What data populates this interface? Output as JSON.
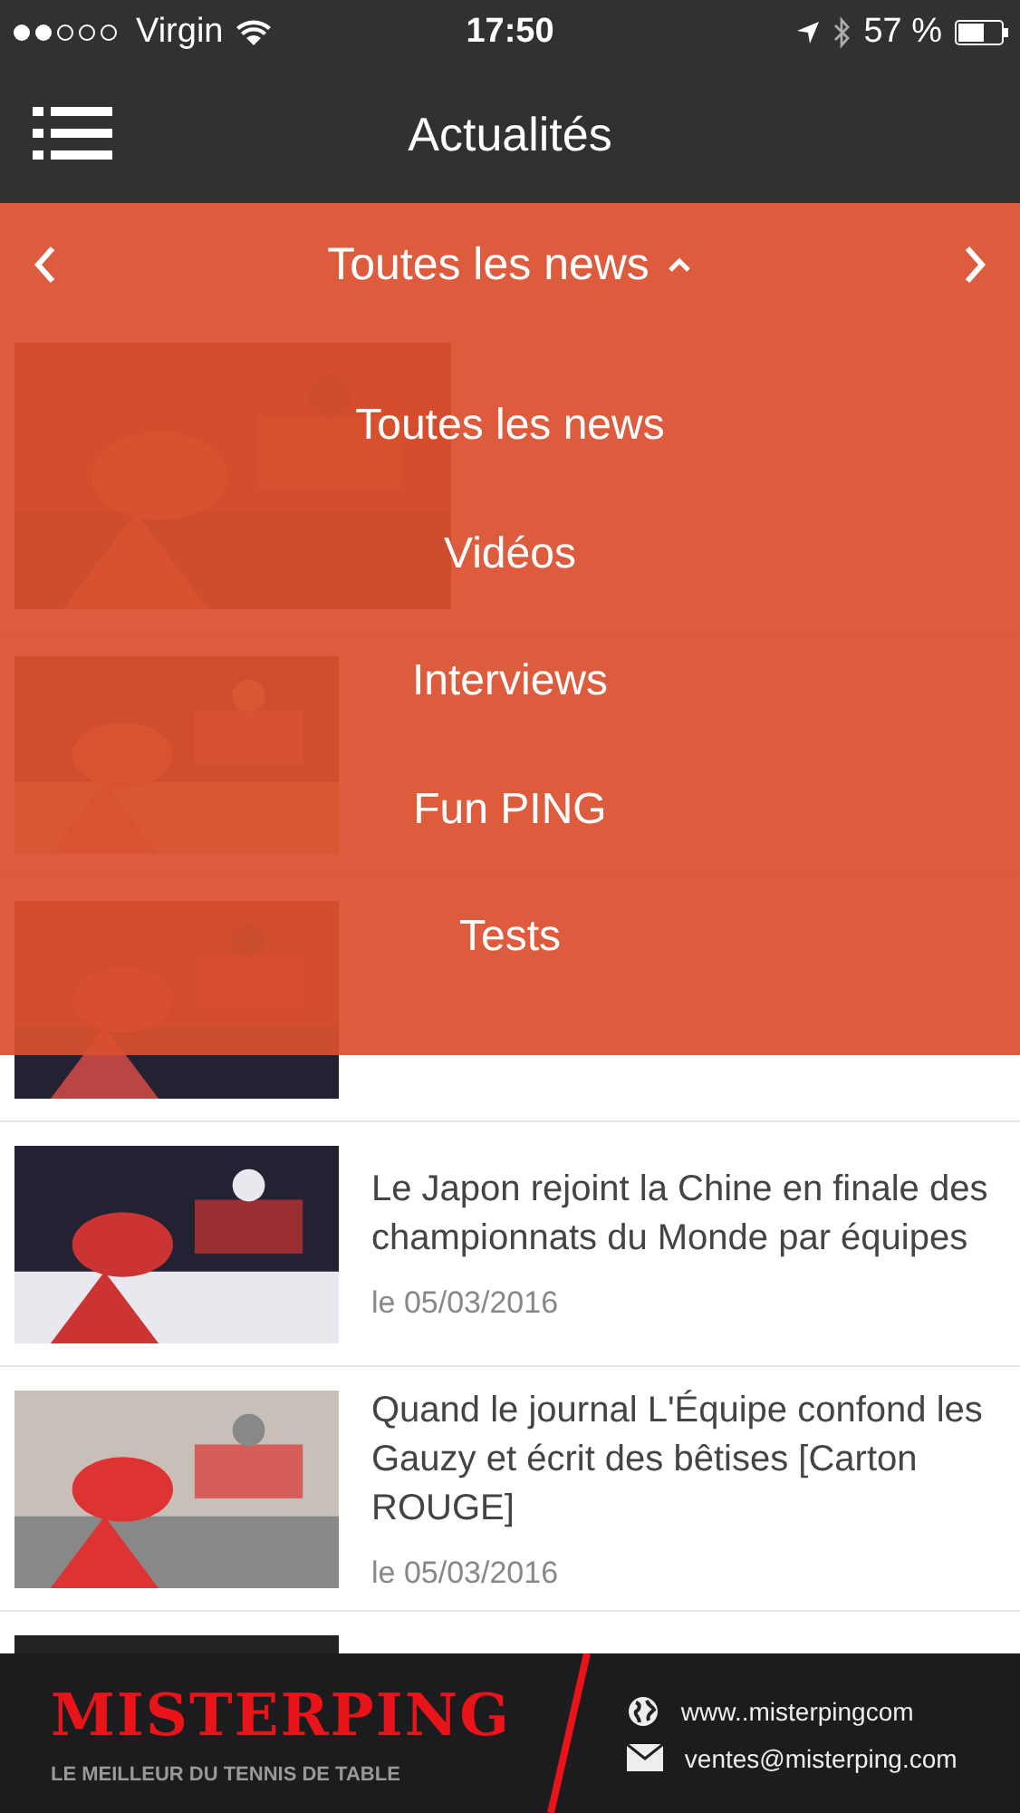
{
  "status_bar": {
    "carrier": "Virgin",
    "time": "17:50",
    "battery": "57 %"
  },
  "header": {
    "title": "Actualités"
  },
  "filter": {
    "current": "Toutes les news",
    "expanded": true,
    "options": [
      "Toutes les news",
      "Vidéos",
      "Interviews",
      "Fun PING",
      "Tests"
    ]
  },
  "articles": [
    {
      "kind": "covered"
    },
    {
      "kind": "covered"
    },
    {
      "kind": "covered"
    },
    {
      "kind": "article",
      "title": "Le Japon rejoint la Chine en finale des championnats du Monde par équipes",
      "date": "le 05/03/2016"
    },
    {
      "kind": "article",
      "title": "Quand le journal L'Équipe confond les Gauzy et écrit des bêtises [Carton ROUGE]",
      "date": "le 05/03/2016"
    },
    {
      "kind": "cut"
    }
  ],
  "footer": {
    "brand": "MISTERPING",
    "tagline": "LE MEILLEUR DU TENNIS DE TABLE",
    "website": "www..misterpingcom",
    "email": "ventes@misterping.com"
  }
}
